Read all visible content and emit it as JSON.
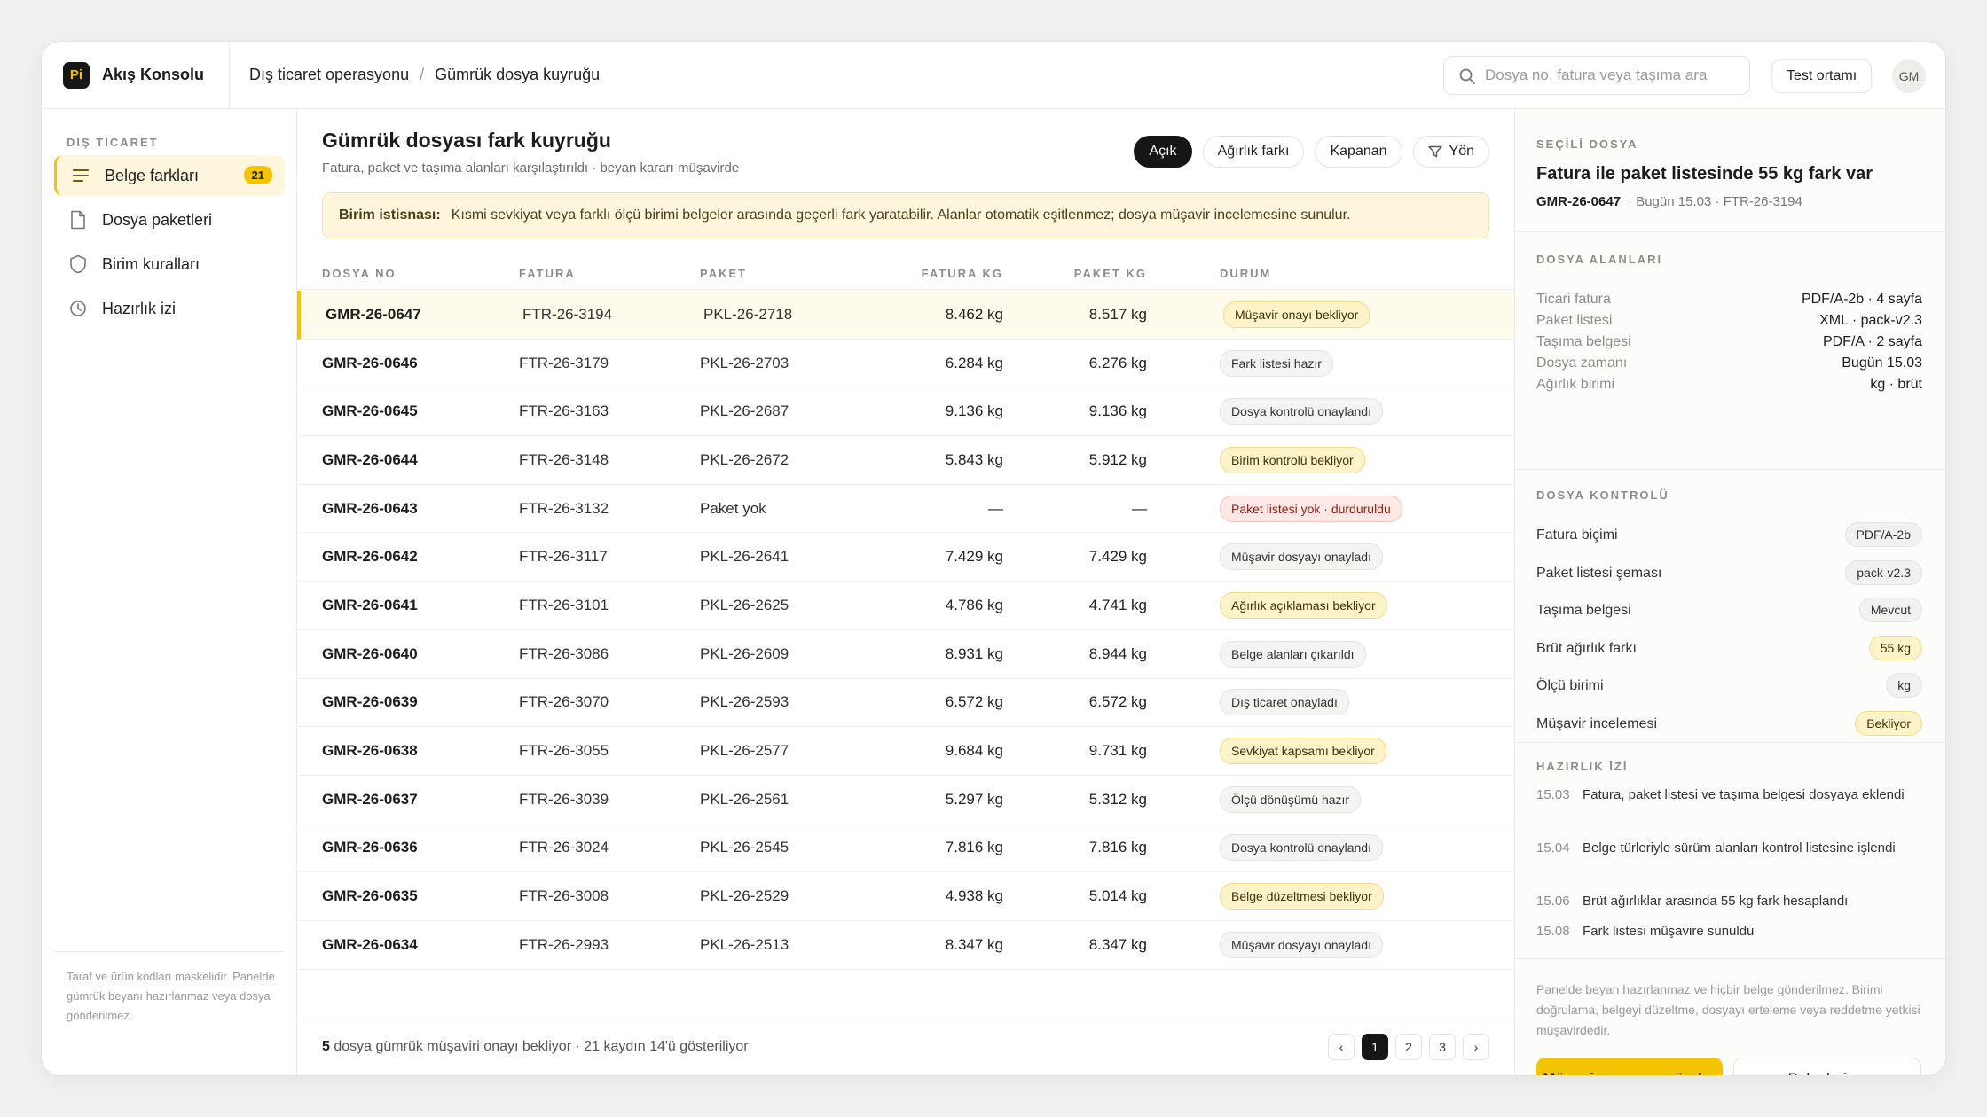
{
  "app": {
    "logo_text": "Pi",
    "name": "Akış Konsolu"
  },
  "breadcrumb": [
    "Dış ticaret operasyonu",
    "Gümrük dosya kuyruğu"
  ],
  "search": {
    "placeholder": "Dosya no, fatura veya taşıma ara"
  },
  "env_label": "Test ortamı",
  "user_initials": "GM",
  "sidebar": {
    "section": "DIŞ TİCARET",
    "items": [
      {
        "label": "Belge farkları",
        "badge": "21",
        "icon": "list-icon"
      },
      {
        "label": "Dosya paketleri",
        "icon": "file-icon"
      },
      {
        "label": "Birim kuralları",
        "icon": "shield-icon"
      },
      {
        "label": "Hazırlık izi",
        "icon": "clock-icon"
      }
    ],
    "note": "Taraf ve ürün kodları maskelidir. Panelde gümrük beyanı hazırlanmaz veya dosya gönderilmez."
  },
  "main": {
    "title": "Gümrük dosyası fark kuyruğu",
    "subtitle": "Fatura, paket ve taşıma alanları karşılaştırıldı · beyan kararı müşavirde",
    "filters": [
      "Açık",
      "Ağırlık farkı",
      "Kapanan",
      "Yön"
    ],
    "notice": {
      "label": "Birim istisnası:",
      "text": "Kısmi sevkiyat veya farklı ölçü birimi belgeler arasında geçerli fark yaratabilir. Alanlar otomatik eşitlenmez; dosya müşavir incelemesine sunulur."
    },
    "columns": [
      "DOSYA NO",
      "FATURA",
      "PAKET",
      "FATURA KG",
      "PAKET KG",
      "DURUM"
    ],
    "rows": [
      {
        "no": "GMR-26-0647",
        "inv": "FTR-26-3194",
        "pkl": "PKL-26-2718",
        "fkg": "8.462 kg",
        "pkg": "8.517 kg",
        "status": "Müşavir onayı bekliyor",
        "tone": "warn"
      },
      {
        "no": "GMR-26-0646",
        "inv": "FTR-26-3179",
        "pkl": "PKL-26-2703",
        "fkg": "6.284 kg",
        "pkg": "6.276 kg",
        "status": "Fark listesi hazır",
        "tone": "neutral"
      },
      {
        "no": "GMR-26-0645",
        "inv": "FTR-26-3163",
        "pkl": "PKL-26-2687",
        "fkg": "9.136 kg",
        "pkg": "9.136 kg",
        "status": "Dosya kontrolü onaylandı",
        "tone": "neutral"
      },
      {
        "no": "GMR-26-0644",
        "inv": "FTR-26-3148",
        "pkl": "PKL-26-2672",
        "fkg": "5.843 kg",
        "pkg": "5.912 kg",
        "status": "Birim kontrolü bekliyor",
        "tone": "warn"
      },
      {
        "no": "GMR-26-0643",
        "inv": "FTR-26-3132",
        "pkl": "Paket yok",
        "fkg": "—",
        "pkg": "—",
        "status": "Paket listesi yok · durduruldu",
        "tone": "err"
      },
      {
        "no": "GMR-26-0642",
        "inv": "FTR-26-3117",
        "pkl": "PKL-26-2641",
        "fkg": "7.429 kg",
        "pkg": "7.429 kg",
        "status": "Müşavir dosyayı onayladı",
        "tone": "neutral"
      },
      {
        "no": "GMR-26-0641",
        "inv": "FTR-26-3101",
        "pkl": "PKL-26-2625",
        "fkg": "4.786 kg",
        "pkg": "4.741 kg",
        "status": "Ağırlık açıklaması bekliyor",
        "tone": "warn"
      },
      {
        "no": "GMR-26-0640",
        "inv": "FTR-26-3086",
        "pkl": "PKL-26-2609",
        "fkg": "8.931 kg",
        "pkg": "8.944 kg",
        "status": "Belge alanları çıkarıldı",
        "tone": "neutral"
      },
      {
        "no": "GMR-26-0639",
        "inv": "FTR-26-3070",
        "pkl": "PKL-26-2593",
        "fkg": "6.572 kg",
        "pkg": "6.572 kg",
        "status": "Dış ticaret onayladı",
        "tone": "neutral"
      },
      {
        "no": "GMR-26-0638",
        "inv": "FTR-26-3055",
        "pkl": "PKL-26-2577",
        "fkg": "9.684 kg",
        "pkg": "9.731 kg",
        "status": "Sevkiyat kapsamı bekliyor",
        "tone": "warn"
      },
      {
        "no": "GMR-26-0637",
        "inv": "FTR-26-3039",
        "pkl": "PKL-26-2561",
        "fkg": "5.297 kg",
        "pkg": "5.312 kg",
        "status": "Ölçü dönüşümü hazır",
        "tone": "neutral"
      },
      {
        "no": "GMR-26-0636",
        "inv": "FTR-26-3024",
        "pkl": "PKL-26-2545",
        "fkg": "7.816 kg",
        "pkg": "7.816 kg",
        "status": "Dosya kontrolü onaylandı",
        "tone": "neutral"
      },
      {
        "no": "GMR-26-0635",
        "inv": "FTR-26-3008",
        "pkl": "PKL-26-2529",
        "fkg": "4.938 kg",
        "pkg": "5.014 kg",
        "status": "Belge düzeltmesi bekliyor",
        "tone": "warn"
      },
      {
        "no": "GMR-26-0634",
        "inv": "FTR-26-2993",
        "pkl": "PKL-26-2513",
        "fkg": "8.347 kg",
        "pkg": "8.347 kg",
        "status": "Müşavir dosyayı onayladı",
        "tone": "neutral"
      }
    ],
    "footer": {
      "count": "5",
      "text": " dosya gümrük müşaviri onayı bekliyor · 21 kaydın 14'ü gösteriliyor"
    },
    "pager": {
      "prev": "‹",
      "pages": [
        "1",
        "2",
        "3"
      ],
      "next": "›"
    }
  },
  "panel": {
    "section_selected": "SEÇİLİ DOSYA",
    "title": "Fatura ile paket listesinde 55 kg fark var",
    "file_no": "GMR-26-0647",
    "file_meta": "· Bugün 15.03 · FTR-26-3194",
    "section_fields": "DOSYA ALANLARI",
    "fields": [
      {
        "k": "Ticari fatura",
        "v": "PDF/A-2b · 4 sayfa"
      },
      {
        "k": "Paket listesi",
        "v": "XML · pack-v2.3"
      },
      {
        "k": "Taşıma belgesi",
        "v": "PDF/A · 2 sayfa"
      },
      {
        "k": "Dosya zamanı",
        "v": "Bugün 15.03"
      },
      {
        "k": "Ağırlık birimi",
        "v": "kg · brüt"
      }
    ],
    "section_checks": "DOSYA KONTROLÜ",
    "checks": [
      {
        "k": "Fatura biçimi",
        "v": "PDF/A-2b",
        "tone": "neutral"
      },
      {
        "k": "Paket listesi şeması",
        "v": "pack-v2.3",
        "tone": "neutral"
      },
      {
        "k": "Taşıma belgesi",
        "v": "Mevcut",
        "tone": "neutral"
      },
      {
        "k": "Brüt ağırlık farkı",
        "v": "55 kg",
        "tone": "warn"
      },
      {
        "k": "Ölçü birimi",
        "v": "kg",
        "tone": "neutral"
      },
      {
        "k": "Müşavir incelemesi",
        "v": "Bekliyor",
        "tone": "warn"
      }
    ],
    "section_trail": "HAZIRLIK İZİ",
    "trail": [
      {
        "t": "15.03",
        "text": "Fatura, paket listesi ve taşıma belgesi dosyaya eklendi"
      },
      {
        "t": "15.04",
        "text": "Belge türleriyle sürüm alanları kontrol listesine işlendi"
      },
      {
        "t": "15.06",
        "text": "Brüt ağırlıklar arasında 55 kg fark hesaplandı"
      },
      {
        "t": "15.08",
        "text": "Fark listesi müşavire sunuldu"
      }
    ],
    "note": "Panelde beyan hazırlanmaz ve hiçbir belge gönderilmez. Birimi doğrulama, belgeyi düzeltme, dosyayı erteleme veya reddetme yetkisi müşavirdedir.",
    "primary_button": "Müşavir onayına gönder",
    "secondary_button": "Belgeleri aç"
  },
  "colors": {
    "accent": "#f5c400",
    "dark": "#161616",
    "warn_bg": "#fdf3c9",
    "err_bg": "#fde8e6"
  }
}
